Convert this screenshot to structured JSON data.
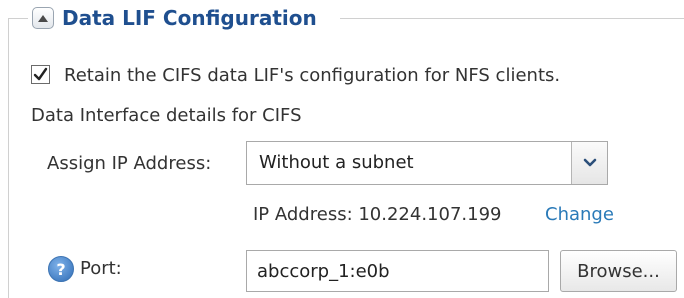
{
  "section": {
    "title": "Data LIF Configuration"
  },
  "retain": {
    "checked": true,
    "label": "Retain the CIFS data LIF's configuration for NFS clients."
  },
  "details_heading": "Data Interface details for CIFS",
  "assign_ip": {
    "label": "Assign IP Address:",
    "selected": "Without a subnet"
  },
  "ip_address": {
    "text": "IP Address: 10.224.107.199",
    "change_label": "Change"
  },
  "port": {
    "label": "Port:",
    "help_glyph": "?",
    "value": "abccorp_1:e0b",
    "browse_label": "Browse..."
  },
  "colors": {
    "title": "#1f4f8f",
    "link": "#2a7ab8",
    "help": "#2f6cb5"
  }
}
